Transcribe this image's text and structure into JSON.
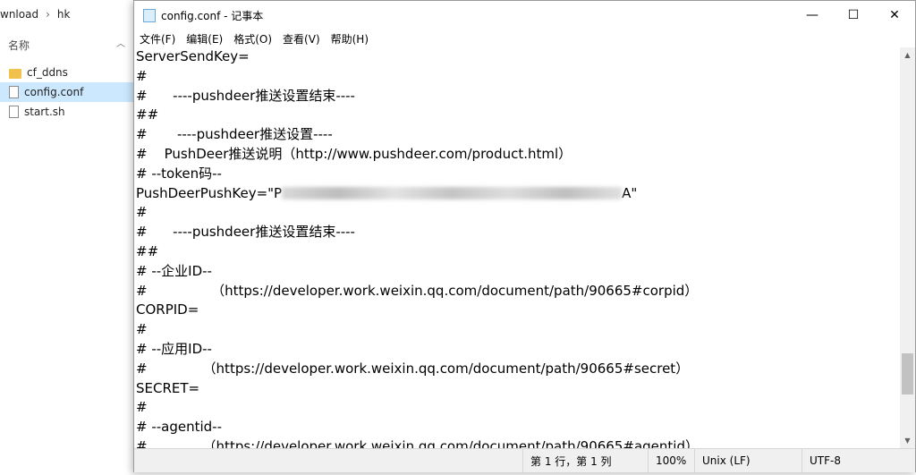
{
  "explorer": {
    "breadcrumb": [
      "wnload",
      "hk"
    ],
    "column_header": "名称",
    "files": [
      {
        "name": "cf_ddns",
        "type": "folder",
        "selected": false
      },
      {
        "name": "config.conf",
        "type": "file",
        "selected": true
      },
      {
        "name": "start.sh",
        "type": "file",
        "selected": false
      }
    ]
  },
  "notepad": {
    "title": "config.conf - 记事本",
    "window_buttons": {
      "minimize": "—",
      "maximize": "☐",
      "close": "✕"
    },
    "menu": [
      "文件(F)",
      "编辑(E)",
      "格式(O)",
      "查看(V)",
      "帮助(H)"
    ],
    "lines": [
      "ServerSendKey=",
      "#",
      "#      ----pushdeer推送设置结束----",
      "##",
      "#       ----pushdeer推送设置----",
      "#    PushDeer推送说明（http://www.pushdeer.com/product.html）",
      "# --token码--",
      "PushDeerPushKey=\"P",
      "#",
      "#      ----pushdeer推送设置结束----",
      "##",
      "# --企业ID--",
      "#               （https://developer.work.weixin.qq.com/document/path/90665#corpid）",
      "CORPID=",
      "#",
      "# --应用ID--",
      "#             （https://developer.work.weixin.qq.com/document/path/90665#secret）",
      "SECRET=",
      "#",
      "# --agentid--",
      "#             （https://developer.work.weixin.qq.com/document/path/90665#agentid）"
    ],
    "pushkey_suffix": "A\"",
    "status": {
      "position": "第 1 行，第 1 列",
      "zoom": "100%",
      "line_ending": "Unix (LF)",
      "encoding": "UTF-8"
    }
  }
}
